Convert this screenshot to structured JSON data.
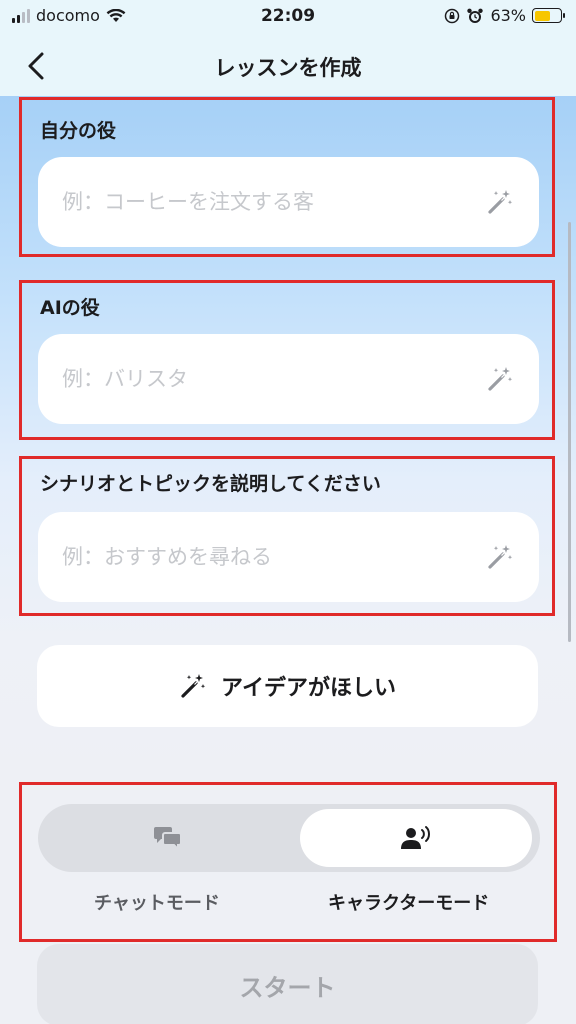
{
  "status_bar": {
    "carrier": "docomo",
    "time": "22:09",
    "battery_percent": "63%",
    "battery_level": 0.63
  },
  "nav": {
    "title": "レッスンを作成"
  },
  "fields": {
    "my_role": {
      "label": "自分の役",
      "placeholder": "例：コーヒーを注文する客",
      "value": ""
    },
    "ai_role": {
      "label": "AIの役",
      "placeholder": "例：バリスタ",
      "value": ""
    },
    "scenario": {
      "label": "シナリオとトピックを説明してください",
      "placeholder": "例：おすすめを尋ねる",
      "value": ""
    }
  },
  "idea_button": {
    "label": "アイデアがほしい"
  },
  "modes": {
    "chat_label": "チャットモード",
    "character_label": "キャラクターモード",
    "selected": "character"
  },
  "start_button": {
    "label": "スタート"
  },
  "colors": {
    "highlight_border": "#e02a2a",
    "accent_gradient_top": "#9dcaf6",
    "battery": "#f7c600"
  },
  "icons": {
    "back": "chevron-left-icon",
    "wand": "magic-wand-icon",
    "chat": "chat-bubbles-icon",
    "character": "person-speaking-icon"
  }
}
